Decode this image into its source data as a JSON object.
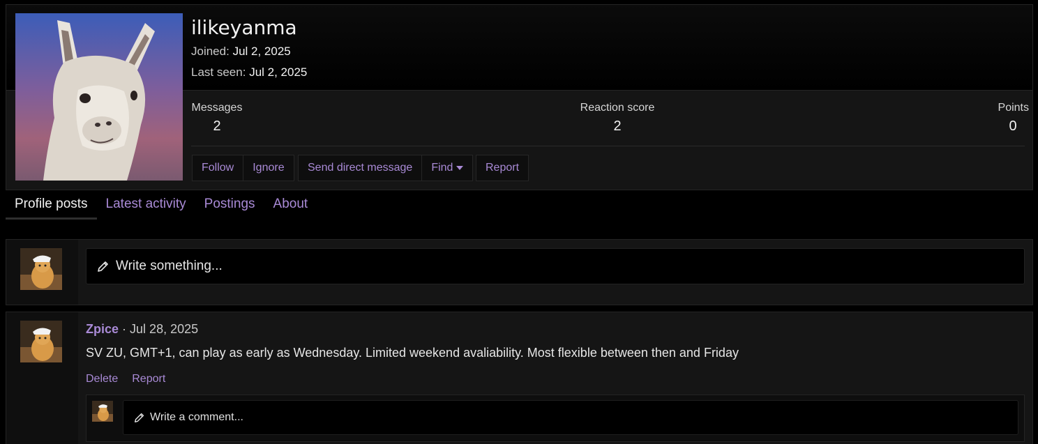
{
  "profile": {
    "username": "ilikeyanma",
    "joined_label": "Joined:",
    "joined_value": "Jul 2, 2025",
    "last_seen_label": "Last seen:",
    "last_seen_value": "Jul 2, 2025",
    "stats": {
      "messages_label": "Messages",
      "messages_value": "2",
      "reaction_label": "Reaction score",
      "reaction_value": "2",
      "points_label": "Points",
      "points_value": "0"
    },
    "buttons": {
      "follow": "Follow",
      "ignore": "Ignore",
      "send_dm": "Send direct message",
      "find": "Find",
      "report": "Report"
    },
    "avatar_icon": "llama-avatar-image"
  },
  "tabs": [
    {
      "label": "Profile posts",
      "active": true
    },
    {
      "label": "Latest activity"
    },
    {
      "label": "Postings"
    },
    {
      "label": "About"
    }
  ],
  "composer": {
    "placeholder": "Write something...",
    "icon": "pencil-icon"
  },
  "post": {
    "author": "Zpice",
    "separator": "·",
    "date": "Jul 28, 2025",
    "body": "SV ZU, GMT+1, can play as early as Wednesday. Limited weekend avaliability. Most flexible between then and Friday",
    "actions": {
      "delete": "Delete",
      "report": "Report"
    },
    "comment_placeholder": "Write a comment..."
  },
  "colors": {
    "accent": "#a98ad6",
    "background": "#000000",
    "panel": "#151515"
  }
}
